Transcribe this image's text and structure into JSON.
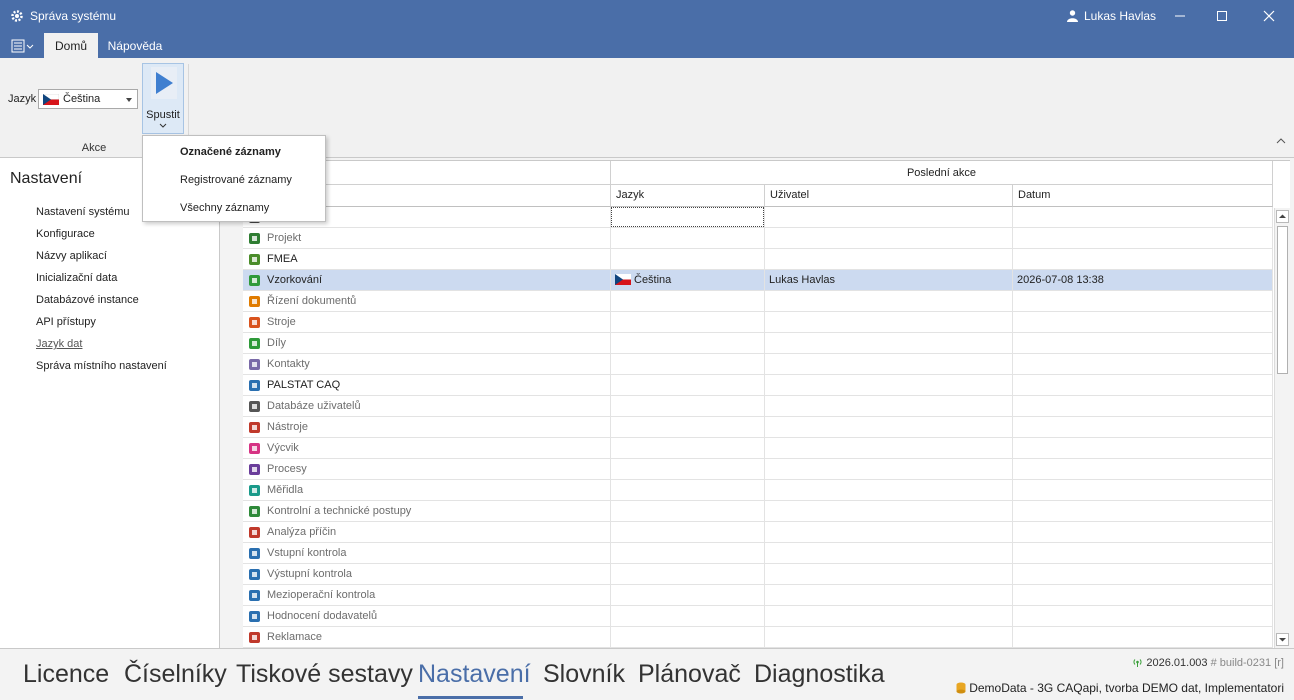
{
  "window": {
    "title": "Správa systému",
    "user": "Lukas Havlas"
  },
  "ribbon_tabs": [
    {
      "label": "Domů",
      "active": true
    },
    {
      "label": "Nápověda",
      "active": false
    }
  ],
  "ribbon": {
    "language_label": "Jazyk",
    "language_value": "Čeština",
    "run_label": "Spustit",
    "group_label": "Akce"
  },
  "run_menu": {
    "items": [
      {
        "label": "Označené záznamy",
        "bold": true
      },
      {
        "label": "Registrované záznamy",
        "bold": false
      },
      {
        "label": "Všechny záznamy",
        "bold": false
      }
    ]
  },
  "left_panel": {
    "title": "Nastavení",
    "items": [
      "Nastavení systému",
      "Konfigurace",
      "Názvy aplikací",
      "Inicializační data",
      "Databázové instance",
      "API přístupy",
      "Jazyk dat",
      "Správa místního nastavení"
    ],
    "selected_index": 6
  },
  "grid": {
    "band_header": "Poslední akce",
    "columns": {
      "language": "Jazyk",
      "user": "Uživatel",
      "date": "Datum"
    },
    "rows": [
      {
        "name": "",
        "icon": "app-icon",
        "dim": false,
        "language": "",
        "user": "",
        "date": ""
      },
      {
        "name": "Projekt",
        "icon": "project-icon",
        "dim": true,
        "language": "",
        "user": "",
        "date": ""
      },
      {
        "name": "FMEA",
        "icon": "fmea-icon",
        "dim": false,
        "language": "",
        "user": "",
        "date": ""
      },
      {
        "name": "Vzorkování",
        "icon": "sampling-icon",
        "dim": false,
        "language": "Čeština",
        "user": "Lukas Havlas",
        "date": "2026-07-08 13:38",
        "selected": true
      },
      {
        "name": "Řízení dokumentů",
        "icon": "documents-icon",
        "dim": true,
        "language": "",
        "user": "",
        "date": ""
      },
      {
        "name": "Stroje",
        "icon": "machines-icon",
        "dim": true,
        "language": "",
        "user": "",
        "date": ""
      },
      {
        "name": "Díly",
        "icon": "parts-icon",
        "dim": true,
        "language": "",
        "user": "",
        "date": ""
      },
      {
        "name": "Kontakty",
        "icon": "contacts-icon",
        "dim": true,
        "language": "",
        "user": "",
        "date": ""
      },
      {
        "name": "PALSTAT CAQ",
        "icon": "palstat-icon",
        "dim": false,
        "language": "",
        "user": "",
        "date": ""
      },
      {
        "name": "Databáze uživatelů",
        "icon": "users-db-icon",
        "dim": true,
        "language": "",
        "user": "",
        "date": ""
      },
      {
        "name": "Nástroje",
        "icon": "tools-icon",
        "dim": true,
        "language": "",
        "user": "",
        "date": ""
      },
      {
        "name": "Výcvik",
        "icon": "training-icon",
        "dim": true,
        "language": "",
        "user": "",
        "date": ""
      },
      {
        "name": "Procesy",
        "icon": "processes-icon",
        "dim": true,
        "language": "",
        "user": "",
        "date": ""
      },
      {
        "name": "Měřidla",
        "icon": "gauges-icon",
        "dim": true,
        "language": "",
        "user": "",
        "date": ""
      },
      {
        "name": "Kontrolní a technické postupy",
        "icon": "procedures-icon",
        "dim": true,
        "language": "",
        "user": "",
        "date": ""
      },
      {
        "name": "Analýza příčin",
        "icon": "root-cause-icon",
        "dim": true,
        "language": "",
        "user": "",
        "date": ""
      },
      {
        "name": "Vstupní kontrola",
        "icon": "incoming-icon",
        "dim": true,
        "language": "",
        "user": "",
        "date": ""
      },
      {
        "name": "Výstupní kontrola",
        "icon": "outgoing-icon",
        "dim": true,
        "language": "",
        "user": "",
        "date": ""
      },
      {
        "name": "Mezioperační kontrola",
        "icon": "inprocess-icon",
        "dim": true,
        "language": "",
        "user": "",
        "date": ""
      },
      {
        "name": "Hodnocení dodavatelů",
        "icon": "supplier-rating-icon",
        "dim": true,
        "language": "",
        "user": "",
        "date": ""
      },
      {
        "name": "Reklamace",
        "icon": "complaints-icon",
        "dim": true,
        "language": "",
        "user": "",
        "date": ""
      }
    ]
  },
  "bottom_tabs": [
    "Licence",
    "Číselníky",
    "Tiskové sestavy",
    "Nastavení",
    "Slovník",
    "Plánovač",
    "Diagnostika"
  ],
  "bottom_active_index": 3,
  "status": {
    "version": "2026.01.003",
    "build": "# build-0231 [r]",
    "database": "DemoData - 3G CAQapi, tvorba DEMO dat, Implementatori"
  },
  "colors": {
    "accent": "#4a6ea8",
    "selection": "#ccdaf0"
  }
}
